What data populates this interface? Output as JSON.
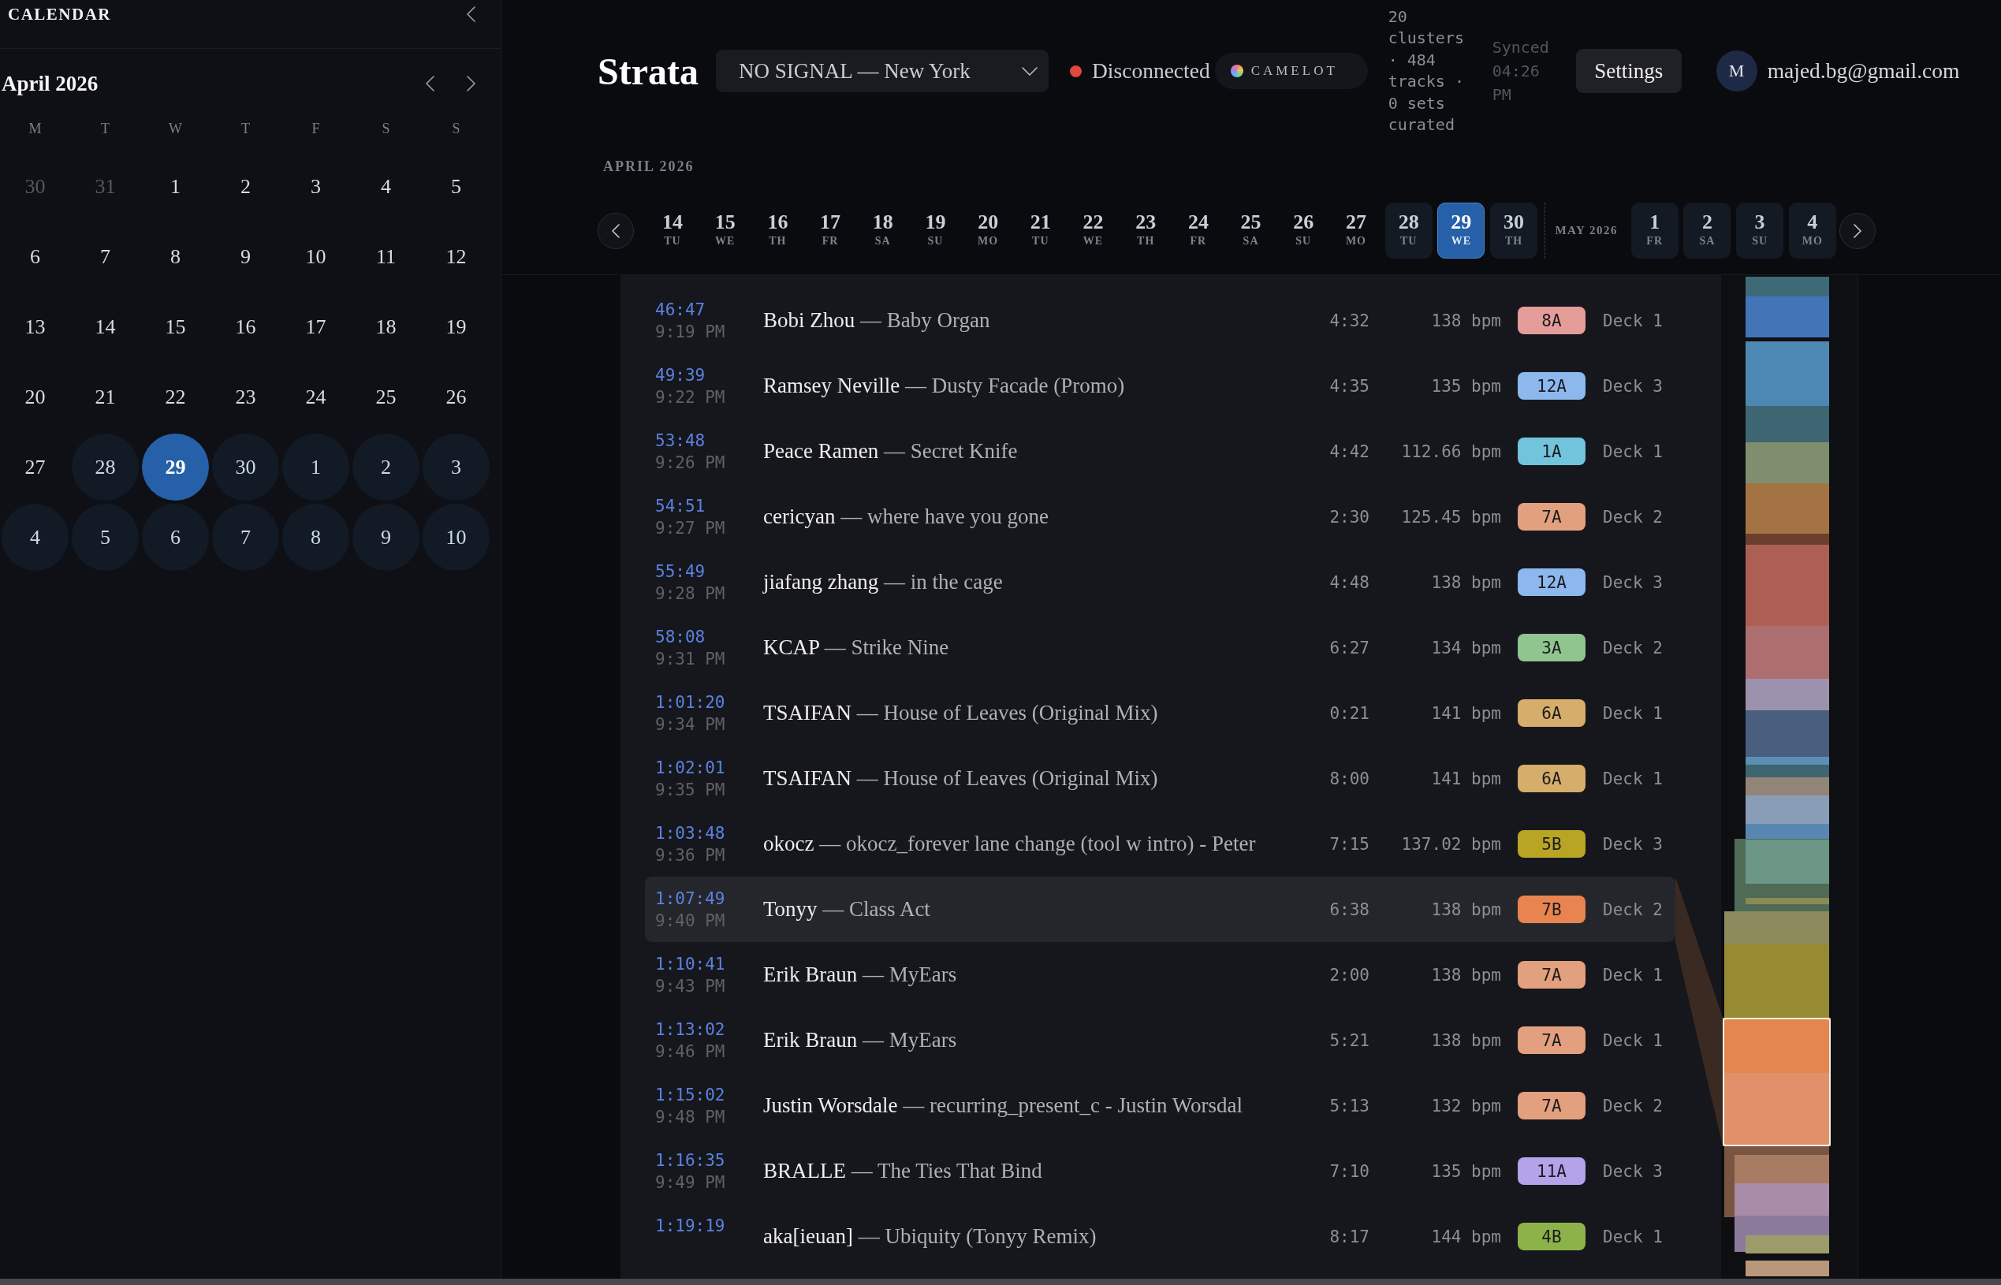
{
  "sidebar": {
    "title": "CALENDAR",
    "month": "April 2026",
    "weekdays": [
      "M",
      "T",
      "W",
      "T",
      "F",
      "S",
      "S"
    ],
    "weeks": [
      [
        {
          "day": "30",
          "muted": true,
          "marked": false,
          "selected": false
        },
        {
          "day": "31",
          "muted": true,
          "marked": false,
          "selected": false
        },
        {
          "day": "1",
          "muted": false,
          "marked": false,
          "selected": false
        },
        {
          "day": "2",
          "muted": false,
          "marked": false,
          "selected": false
        },
        {
          "day": "3",
          "muted": false,
          "marked": false,
          "selected": false
        },
        {
          "day": "4",
          "muted": false,
          "marked": false,
          "selected": false
        },
        {
          "day": "5",
          "muted": false,
          "marked": false,
          "selected": false
        }
      ],
      [
        {
          "day": "6",
          "muted": false,
          "marked": false,
          "selected": false
        },
        {
          "day": "7",
          "muted": false,
          "marked": false,
          "selected": false
        },
        {
          "day": "8",
          "muted": false,
          "marked": false,
          "selected": false
        },
        {
          "day": "9",
          "muted": false,
          "marked": false,
          "selected": false
        },
        {
          "day": "10",
          "muted": false,
          "marked": false,
          "selected": false
        },
        {
          "day": "11",
          "muted": false,
          "marked": false,
          "selected": false
        },
        {
          "day": "12",
          "muted": false,
          "marked": false,
          "selected": false
        }
      ],
      [
        {
          "day": "13",
          "muted": false,
          "marked": false,
          "selected": false
        },
        {
          "day": "14",
          "muted": false,
          "marked": false,
          "selected": false
        },
        {
          "day": "15",
          "muted": false,
          "marked": false,
          "selected": false
        },
        {
          "day": "16",
          "muted": false,
          "marked": false,
          "selected": false
        },
        {
          "day": "17",
          "muted": false,
          "marked": false,
          "selected": false
        },
        {
          "day": "18",
          "muted": false,
          "marked": false,
          "selected": false
        },
        {
          "day": "19",
          "muted": false,
          "marked": false,
          "selected": false
        }
      ],
      [
        {
          "day": "20",
          "muted": false,
          "marked": false,
          "selected": false
        },
        {
          "day": "21",
          "muted": false,
          "marked": false,
          "selected": false
        },
        {
          "day": "22",
          "muted": false,
          "marked": false,
          "selected": false
        },
        {
          "day": "23",
          "muted": false,
          "marked": false,
          "selected": false
        },
        {
          "day": "24",
          "muted": false,
          "marked": false,
          "selected": false
        },
        {
          "day": "25",
          "muted": false,
          "marked": false,
          "selected": false
        },
        {
          "day": "26",
          "muted": false,
          "marked": false,
          "selected": false
        }
      ],
      [
        {
          "day": "27",
          "muted": false,
          "marked": false,
          "selected": false
        },
        {
          "day": "28",
          "muted": false,
          "marked": true,
          "selected": false
        },
        {
          "day": "29",
          "muted": false,
          "marked": true,
          "selected": true
        },
        {
          "day": "30",
          "muted": false,
          "marked": true,
          "selected": false
        },
        {
          "day": "1",
          "muted": false,
          "marked": true,
          "selected": false
        },
        {
          "day": "2",
          "muted": false,
          "marked": true,
          "selected": false
        },
        {
          "day": "3",
          "muted": false,
          "marked": true,
          "selected": false
        }
      ],
      [
        {
          "day": "4",
          "muted": false,
          "marked": true,
          "selected": false
        },
        {
          "day": "5",
          "muted": false,
          "marked": true,
          "selected": false
        },
        {
          "day": "6",
          "muted": false,
          "marked": true,
          "selected": false
        },
        {
          "day": "7",
          "muted": false,
          "marked": true,
          "selected": false
        },
        {
          "day": "8",
          "muted": false,
          "marked": true,
          "selected": false
        },
        {
          "day": "9",
          "muted": false,
          "marked": true,
          "selected": false
        },
        {
          "day": "10",
          "muted": false,
          "marked": true,
          "selected": false
        }
      ]
    ]
  },
  "header": {
    "brand": "Strata",
    "station": {
      "value": "NO SIGNAL — New York"
    },
    "status": {
      "label": "Disconnected",
      "connected": false
    },
    "key_notation": "CAMELOT",
    "stats": "20 clusters · 484 tracks · 0 sets curated",
    "synced": "Synced 04:26 PM",
    "settings": "Settings",
    "user": {
      "initial": "M",
      "email": "majed.bg@gmail.com"
    }
  },
  "date_strip": {
    "groups": [
      {
        "label": "APRIL 2026",
        "days": [
          {
            "day": "14",
            "weekday": "TU",
            "marked": false,
            "selected": false
          },
          {
            "day": "15",
            "weekday": "WE",
            "marked": false,
            "selected": false
          },
          {
            "day": "16",
            "weekday": "TH",
            "marked": false,
            "selected": false
          },
          {
            "day": "17",
            "weekday": "FR",
            "marked": false,
            "selected": false
          },
          {
            "day": "18",
            "weekday": "SA",
            "marked": false,
            "selected": false
          },
          {
            "day": "19",
            "weekday": "SU",
            "marked": false,
            "selected": false
          },
          {
            "day": "20",
            "weekday": "MO",
            "marked": false,
            "selected": false
          },
          {
            "day": "21",
            "weekday": "TU",
            "marked": false,
            "selected": false
          },
          {
            "day": "22",
            "weekday": "WE",
            "marked": false,
            "selected": false
          },
          {
            "day": "23",
            "weekday": "TH",
            "marked": false,
            "selected": false
          },
          {
            "day": "24",
            "weekday": "FR",
            "marked": false,
            "selected": false
          },
          {
            "day": "25",
            "weekday": "SA",
            "marked": false,
            "selected": false
          },
          {
            "day": "26",
            "weekday": "SU",
            "marked": false,
            "selected": false
          },
          {
            "day": "27",
            "weekday": "MO",
            "marked": false,
            "selected": false
          },
          {
            "day": "28",
            "weekday": "TU",
            "marked": true,
            "selected": false
          },
          {
            "day": "29",
            "weekday": "WE",
            "marked": true,
            "selected": true
          },
          {
            "day": "30",
            "weekday": "TH",
            "marked": true,
            "selected": false
          }
        ]
      },
      {
        "label": "MAY 2026",
        "days": [
          {
            "day": "1",
            "weekday": "FR",
            "marked": true,
            "selected": false
          },
          {
            "day": "2",
            "weekday": "SA",
            "marked": true,
            "selected": false
          },
          {
            "day": "3",
            "weekday": "SU",
            "marked": true,
            "selected": false
          },
          {
            "day": "4",
            "weekday": "MO",
            "marked": true,
            "selected": false
          }
        ]
      }
    ]
  },
  "tracks": {
    "rows": [
      {
        "time": "46:47",
        "clock": "9:19 PM",
        "artist": "Bobi Zhou",
        "separator": "—",
        "title": "Baby Organ",
        "duration": "4:32",
        "bpm": "138 bpm",
        "key": "8A",
        "color": "#e59d9a",
        "deck": "Deck 1",
        "selected": false
      },
      {
        "time": "49:39",
        "clock": "9:22 PM",
        "artist": "Ramsey Neville",
        "separator": "—",
        "title": "Dusty Facade (Promo)",
        "duration": "4:35",
        "bpm": "135 bpm",
        "key": "12A",
        "color": "#8cb8ee",
        "deck": "Deck 3",
        "selected": false
      },
      {
        "time": "53:48",
        "clock": "9:26 PM",
        "artist": "Peace Ramen",
        "separator": "—",
        "title": "Secret Knife",
        "duration": "4:42",
        "bpm": "112.66 bpm",
        "key": "1A",
        "color": "#72c3dc",
        "deck": "Deck 1",
        "selected": false
      },
      {
        "time": "54:51",
        "clock": "9:27 PM",
        "artist": "cericyan",
        "separator": "—",
        "title": "where have you gone",
        "duration": "2:30",
        "bpm": "125.45 bpm",
        "key": "7A",
        "color": "#e3a07f",
        "deck": "Deck 2",
        "selected": false
      },
      {
        "time": "55:49",
        "clock": "9:28 PM",
        "artist": "jiafang zhang",
        "separator": "—",
        "title": "in the cage",
        "duration": "4:48",
        "bpm": "138 bpm",
        "key": "12A",
        "color": "#8cb8ee",
        "deck": "Deck 3",
        "selected": false
      },
      {
        "time": "58:08",
        "clock": "9:31 PM",
        "artist": "KCAP",
        "separator": "—",
        "title": "Strike Nine",
        "duration": "6:27",
        "bpm": "134 bpm",
        "key": "3A",
        "color": "#90c590",
        "deck": "Deck 2",
        "selected": false
      },
      {
        "time": "1:01:20",
        "clock": "9:34 PM",
        "artist": "TSAIFAN",
        "separator": "—",
        "title": "House of Leaves (Original Mix)",
        "duration": "0:21",
        "bpm": "141 bpm",
        "key": "6A",
        "color": "#d6ad6a",
        "deck": "Deck 1",
        "selected": false
      },
      {
        "time": "1:02:01",
        "clock": "9:35 PM",
        "artist": "TSAIFAN",
        "separator": "—",
        "title": "House of Leaves (Original Mix)",
        "duration": "8:00",
        "bpm": "141 bpm",
        "key": "6A",
        "color": "#d6ad6a",
        "deck": "Deck 1",
        "selected": false
      },
      {
        "time": "1:03:48",
        "clock": "9:36 PM",
        "artist": "okocz",
        "separator": "—",
        "title": "okocz_forever lane change (tool w intro) - Peter",
        "duration": "7:15",
        "bpm": "137.02 bpm",
        "key": "5B",
        "color": "#b9a524",
        "deck": "Deck 3",
        "selected": false
      },
      {
        "time": "1:07:49",
        "clock": "9:40 PM",
        "artist": "Tonyy",
        "separator": "—",
        "title": "Class Act",
        "duration": "6:38",
        "bpm": "138 bpm",
        "key": "7B",
        "color": "#e8844f",
        "deck": "Deck 2",
        "selected": true
      },
      {
        "time": "1:10:41",
        "clock": "9:43 PM",
        "artist": "Erik Braun",
        "separator": "—",
        "title": "MyEars",
        "duration": "2:00",
        "bpm": "138 bpm",
        "key": "7A",
        "color": "#e3a07f",
        "deck": "Deck 1",
        "selected": false
      },
      {
        "time": "1:13:02",
        "clock": "9:46 PM",
        "artist": "Erik Braun",
        "separator": "—",
        "title": "MyEars",
        "duration": "5:21",
        "bpm": "138 bpm",
        "key": "7A",
        "color": "#e3a07f",
        "deck": "Deck 1",
        "selected": false
      },
      {
        "time": "1:15:02",
        "clock": "9:48 PM",
        "artist": "Justin Worsdale",
        "separator": "—",
        "title": "recurring_present_c - Justin Worsdal",
        "duration": "5:13",
        "bpm": "132 bpm",
        "key": "7A",
        "color": "#e3a07f",
        "deck": "Deck 2",
        "selected": false
      },
      {
        "time": "1:16:35",
        "clock": "9:49 PM",
        "artist": "BRALLE",
        "separator": "—",
        "title": "The Ties That Bind",
        "duration": "7:10",
        "bpm": "135 bpm",
        "key": "11A",
        "color": "#b4a2ea",
        "deck": "Deck 3",
        "selected": false
      },
      {
        "time": "1:19:19",
        "artist": "aka[ieuan]",
        "separator": "—",
        "title": "Ubiquity (Tonyy Remix)",
        "duration": "8:17",
        "bpm": "144 bpm",
        "key": "4B",
        "color": "#8db24a",
        "deck": "Deck 1",
        "selected": false
      }
    ]
  }
}
